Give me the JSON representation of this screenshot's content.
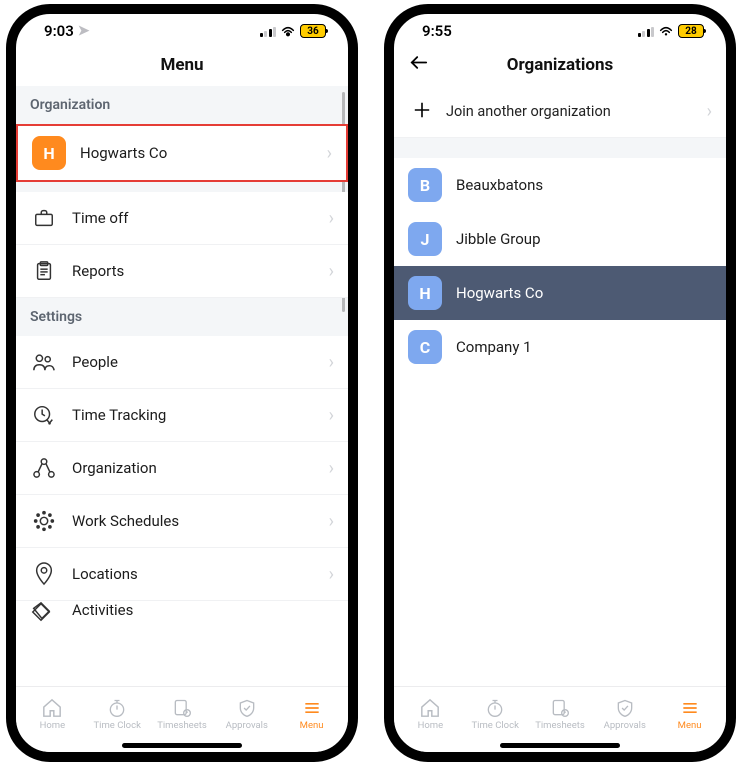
{
  "left": {
    "status": {
      "time": "9:03",
      "battery": "36"
    },
    "title": "Menu",
    "section_org": "Organization",
    "org": {
      "initial": "H",
      "name": "Hogwarts Co"
    },
    "items": [
      {
        "label": "Time off"
      },
      {
        "label": "Reports"
      }
    ],
    "section_settings": "Settings",
    "settings": [
      {
        "label": "People"
      },
      {
        "label": "Time Tracking"
      },
      {
        "label": "Organization"
      },
      {
        "label": "Work Schedules"
      },
      {
        "label": "Locations"
      },
      {
        "label": "Activities"
      }
    ]
  },
  "right": {
    "status": {
      "time": "9:55",
      "battery": "28"
    },
    "title": "Organizations",
    "join": "Join another organization",
    "orgs": [
      {
        "initial": "B",
        "name": "Beauxbatons",
        "selected": false
      },
      {
        "initial": "J",
        "name": "Jibble Group",
        "selected": false
      },
      {
        "initial": "H",
        "name": "Hogwarts Co",
        "selected": true
      },
      {
        "initial": "C",
        "name": "Company 1",
        "selected": false
      }
    ]
  },
  "tabs": [
    {
      "label": "Home"
    },
    {
      "label": "Time Clock"
    },
    {
      "label": "Timesheets"
    },
    {
      "label": "Approvals"
    },
    {
      "label": "Menu"
    }
  ]
}
